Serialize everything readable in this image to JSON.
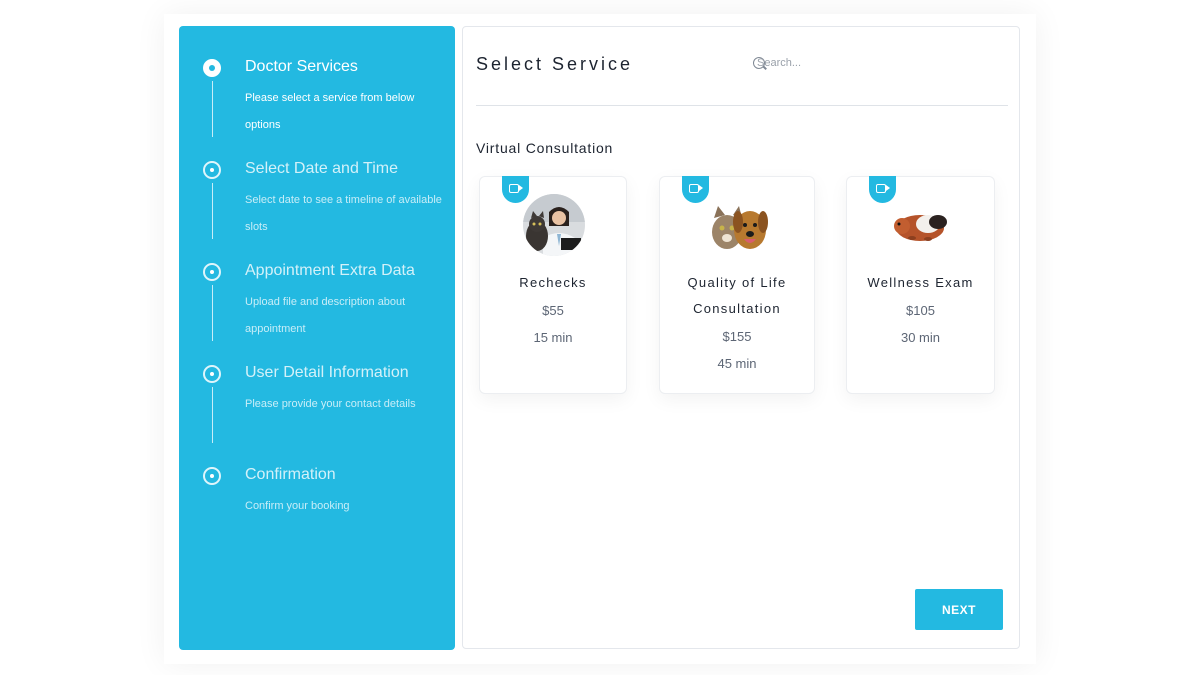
{
  "sidebar": {
    "steps": [
      {
        "title": "Doctor Services",
        "desc": "Please select a service from below options"
      },
      {
        "title": "Select Date and Time",
        "desc": "Select date to see a timeline of available slots"
      },
      {
        "title": "Appointment Extra Data",
        "desc": "Upload file and description about appointment"
      },
      {
        "title": "User Detail Information",
        "desc": "Please provide your contact details"
      },
      {
        "title": "Confirmation",
        "desc": "Confirm your booking"
      }
    ]
  },
  "main": {
    "title": "Select Service",
    "search_placeholder": "Search...",
    "section_title": "Virtual Consultation",
    "services": [
      {
        "name": "Rechecks",
        "price": "$55",
        "duration": "15 min",
        "icon": "video-icon",
        "image": "doctor-with-cat-photo"
      },
      {
        "name": "Quality of Life Consultation",
        "price": "$155",
        "duration": "45 min",
        "icon": "video-icon",
        "image": "cat-and-dog-photo"
      },
      {
        "name": "Wellness Exam",
        "price": "$105",
        "duration": "30 min",
        "icon": "video-icon",
        "image": "guinea-pig-photo"
      }
    ],
    "next_label": "NEXT"
  },
  "colors": {
    "accent": "#23b9e1",
    "text_dark": "#1d2430",
    "text_muted": "#5d6675"
  }
}
